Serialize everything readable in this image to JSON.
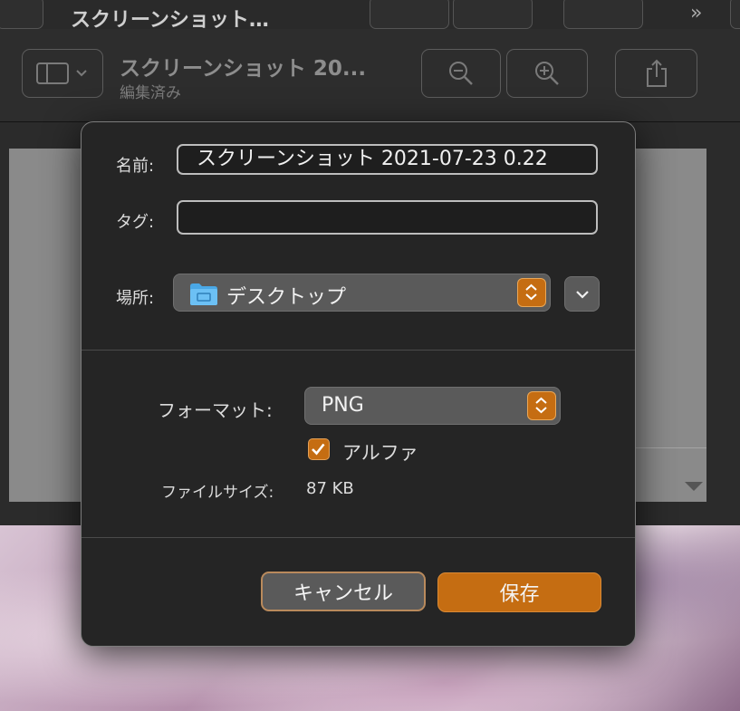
{
  "background_window": {
    "top_title": "スクリーンショット…",
    "title": "スクリーンショット 20...",
    "subtitle": "編集済み"
  },
  "save_sheet": {
    "name_label": "名前:",
    "name_value": "スクリーンショット 2021-07-23 0.22",
    "tags_label": "タグ:",
    "tags_value": "",
    "location_label": "場所:",
    "location_value": "デスクトップ",
    "format_label": "フォーマット:",
    "format_value": "PNG",
    "alpha_label": "アルファ",
    "alpha_checked": true,
    "filesize_label": "ファイルサイズ:",
    "filesize_value": "87 KB",
    "cancel_label": "キャンセル",
    "save_label": "保存"
  },
  "colors": {
    "accent": "#c56d12",
    "sheet_bg": "#252525"
  }
}
